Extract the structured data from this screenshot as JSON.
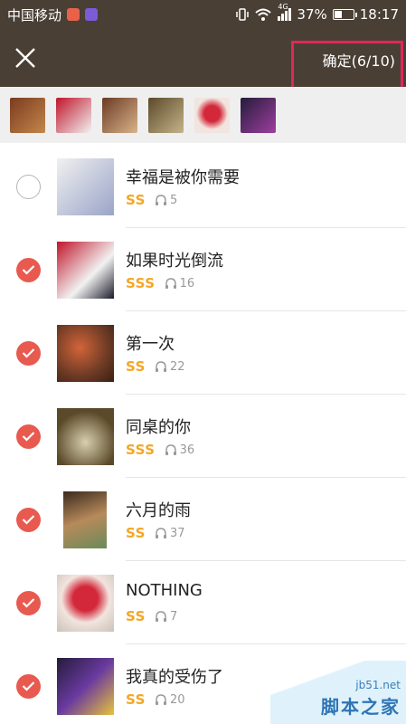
{
  "status_bar": {
    "carrier": "中国移动",
    "network": "4G",
    "battery": "37%",
    "battery_level": 0.37,
    "time": "18:17"
  },
  "header": {
    "confirm_label": "确定(6/10)"
  },
  "selected_count": 6,
  "songs": [
    {
      "title": "幸福是被你需要",
      "level": "SS",
      "plays": "5",
      "checked": false
    },
    {
      "title": "如果时光倒流",
      "level": "SSS",
      "plays": "16",
      "checked": true
    },
    {
      "title": "第一次",
      "level": "SS",
      "plays": "22",
      "checked": true
    },
    {
      "title": "同桌的你",
      "level": "SSS",
      "plays": "36",
      "checked": true
    },
    {
      "title": "六月的雨",
      "level": "SS",
      "plays": "37",
      "checked": true
    },
    {
      "title": "NOTHING",
      "level": "SS",
      "plays": "7",
      "checked": true
    },
    {
      "title": "我真的受伤了",
      "level": "SS",
      "plays": "20",
      "checked": true
    }
  ],
  "watermark": {
    "url": "jb51.net",
    "text": "脚本之家"
  },
  "colors": {
    "header_bg": "#4a3f35",
    "check_active": "#e85a4f",
    "level_text": "#f5a623",
    "highlight_box": "#e0265a"
  }
}
